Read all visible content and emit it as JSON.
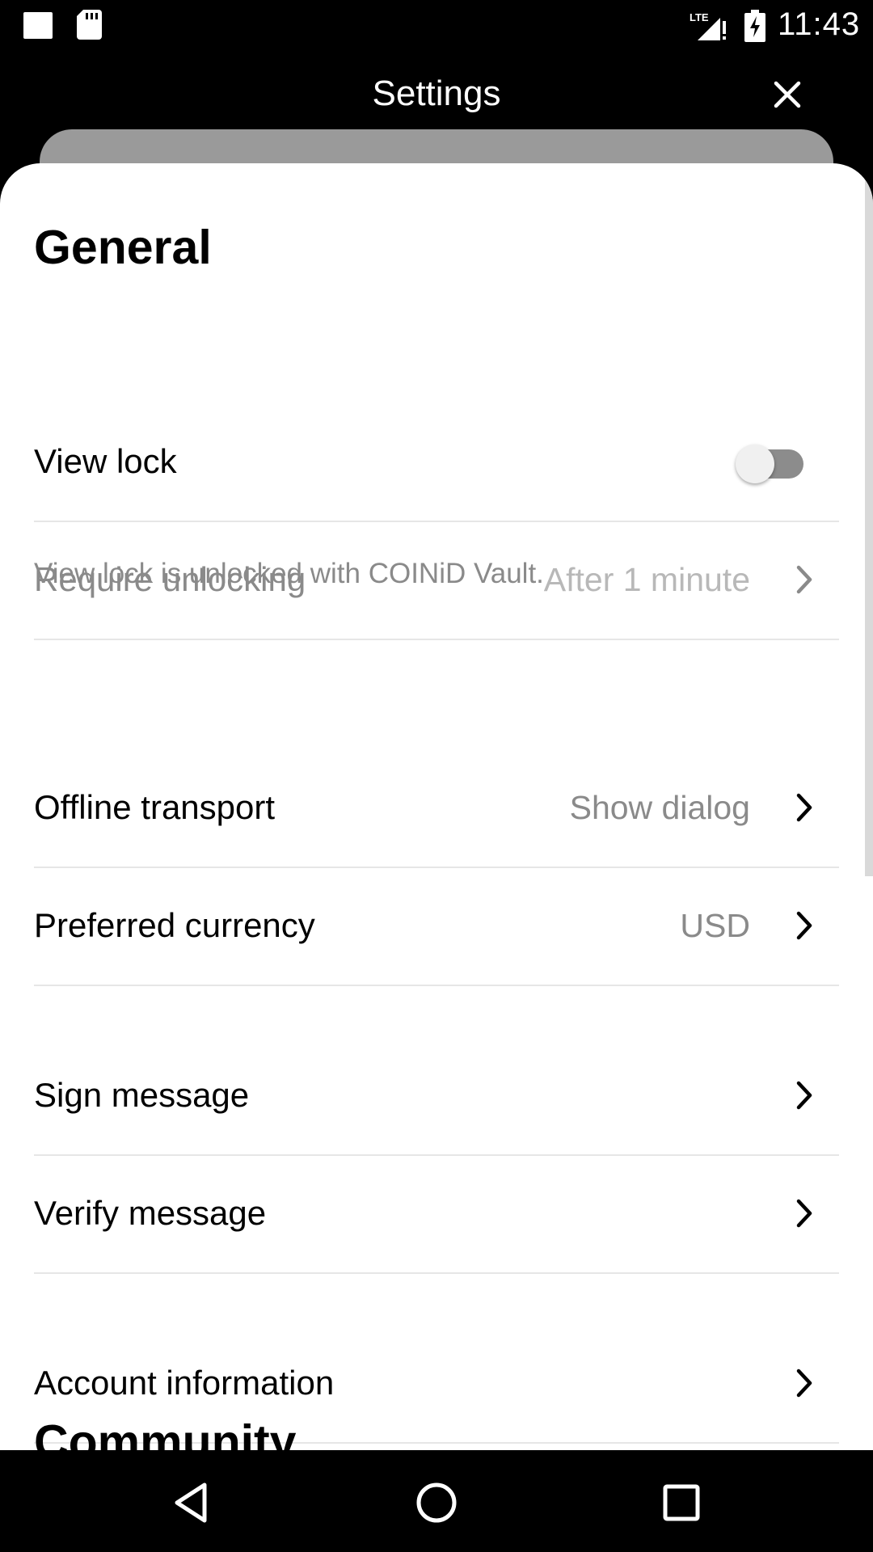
{
  "status_bar": {
    "time": "11:43",
    "network": "LTE",
    "icons": [
      "notification-square-icon",
      "sd-card-icon",
      "signal-icon",
      "battery-charging-icon"
    ]
  },
  "header": {
    "title": "Settings",
    "close_icon": "close-icon"
  },
  "general": {
    "title": "General",
    "view_lock": {
      "label": "View lock",
      "enabled": false
    },
    "require_unlocking": {
      "label": "Require unlocking",
      "value": "After 1 minute",
      "disabled": true
    },
    "note": "View lock is unlocked with COINiD Vault.",
    "offline_transport": {
      "label": "Offline transport",
      "value": "Show dialog"
    },
    "preferred_currency": {
      "label": "Preferred currency",
      "value": "USD"
    },
    "sign_message": {
      "label": "Sign message"
    },
    "verify_message": {
      "label": "Verify message"
    },
    "account_information": {
      "label": "Account information"
    }
  },
  "community": {
    "title": "Community"
  },
  "nav_bar": {
    "icons": [
      "back-icon",
      "home-icon",
      "recents-icon"
    ]
  },
  "colors": {
    "background": "#000000",
    "sheet": "#ffffff",
    "secondary_text": "#8a8a8a",
    "disabled_text": "#b8b8b8",
    "divider": "#e6e6e6"
  }
}
